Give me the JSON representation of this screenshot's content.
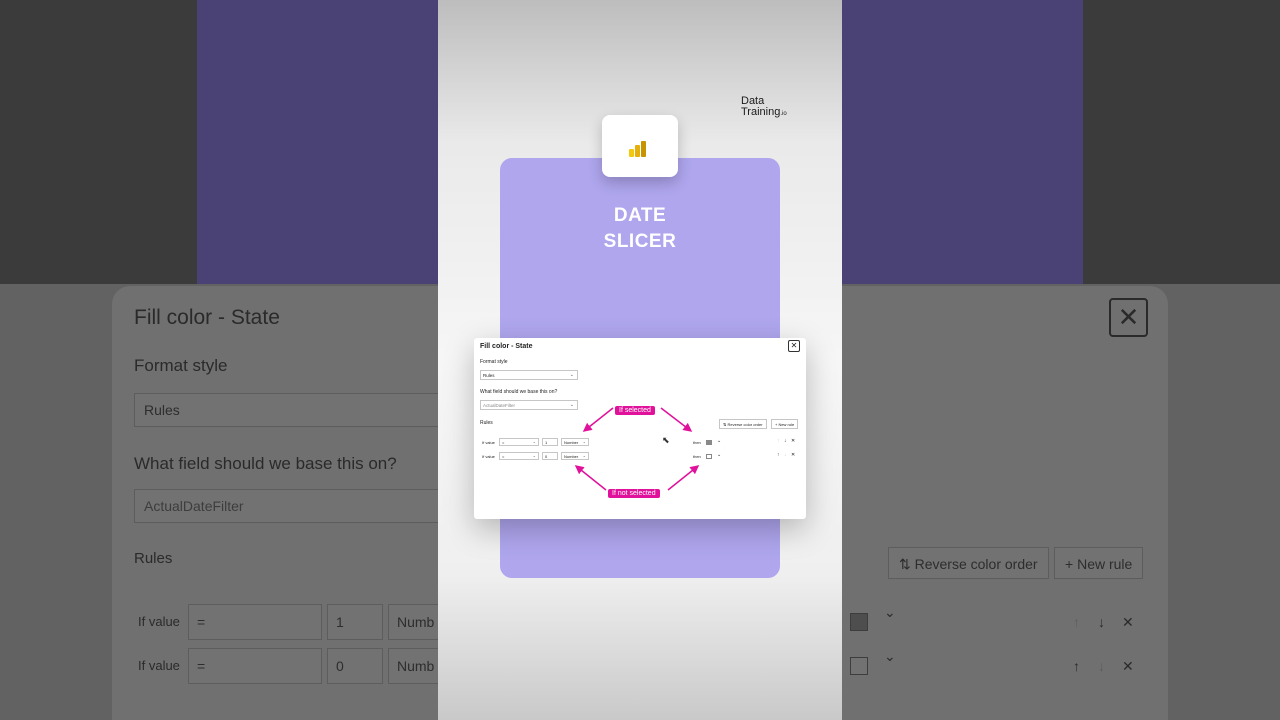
{
  "background": {
    "dialog_title": "Fill color - State",
    "format_style_label": "Format style",
    "format_style_value": "Rules",
    "field_label": "What field should we base this on?",
    "field_value": "ActualDateFilter",
    "rules_label": "Rules",
    "reverse_button": "Reverse color order",
    "new_rule_button": "New rule",
    "rows": [
      {
        "label": "If value",
        "operator": "=",
        "value": "1",
        "type": "Numb"
      },
      {
        "label": "If value",
        "operator": "=",
        "value": "0",
        "type": "Numb"
      }
    ],
    "close_glyph": "✕"
  },
  "short": {
    "brand_line1": "Data",
    "brand_line2": "Training",
    "brand_suffix": ".io",
    "card_title_line1": "DATE",
    "card_title_line2": "SLICER",
    "logo_icon": "power-bi-icon",
    "dialog": {
      "title": "Fill color - State",
      "close_glyph": "✕",
      "format_style_label": "Format style",
      "format_style_value": "Rules",
      "field_label": "What field should we base this on?",
      "field_value": "ActualDateFilter",
      "rules_label": "Rules",
      "reverse_button": "⇅ Reverse color order",
      "new_rule_button": "+ New rule",
      "rows": [
        {
          "label": "If value",
          "operator": "=",
          "value": "1",
          "type": "Number",
          "then": "then"
        },
        {
          "label": "If value",
          "operator": "=",
          "value": "0",
          "type": "Number",
          "then": "then"
        }
      ],
      "annotation_selected": "If selected",
      "annotation_not_selected": "If not selected"
    }
  },
  "colors": {
    "accent_pink": "#e0119a",
    "card_purple": "#afa6ee",
    "bg_purple": "#4a4175"
  }
}
